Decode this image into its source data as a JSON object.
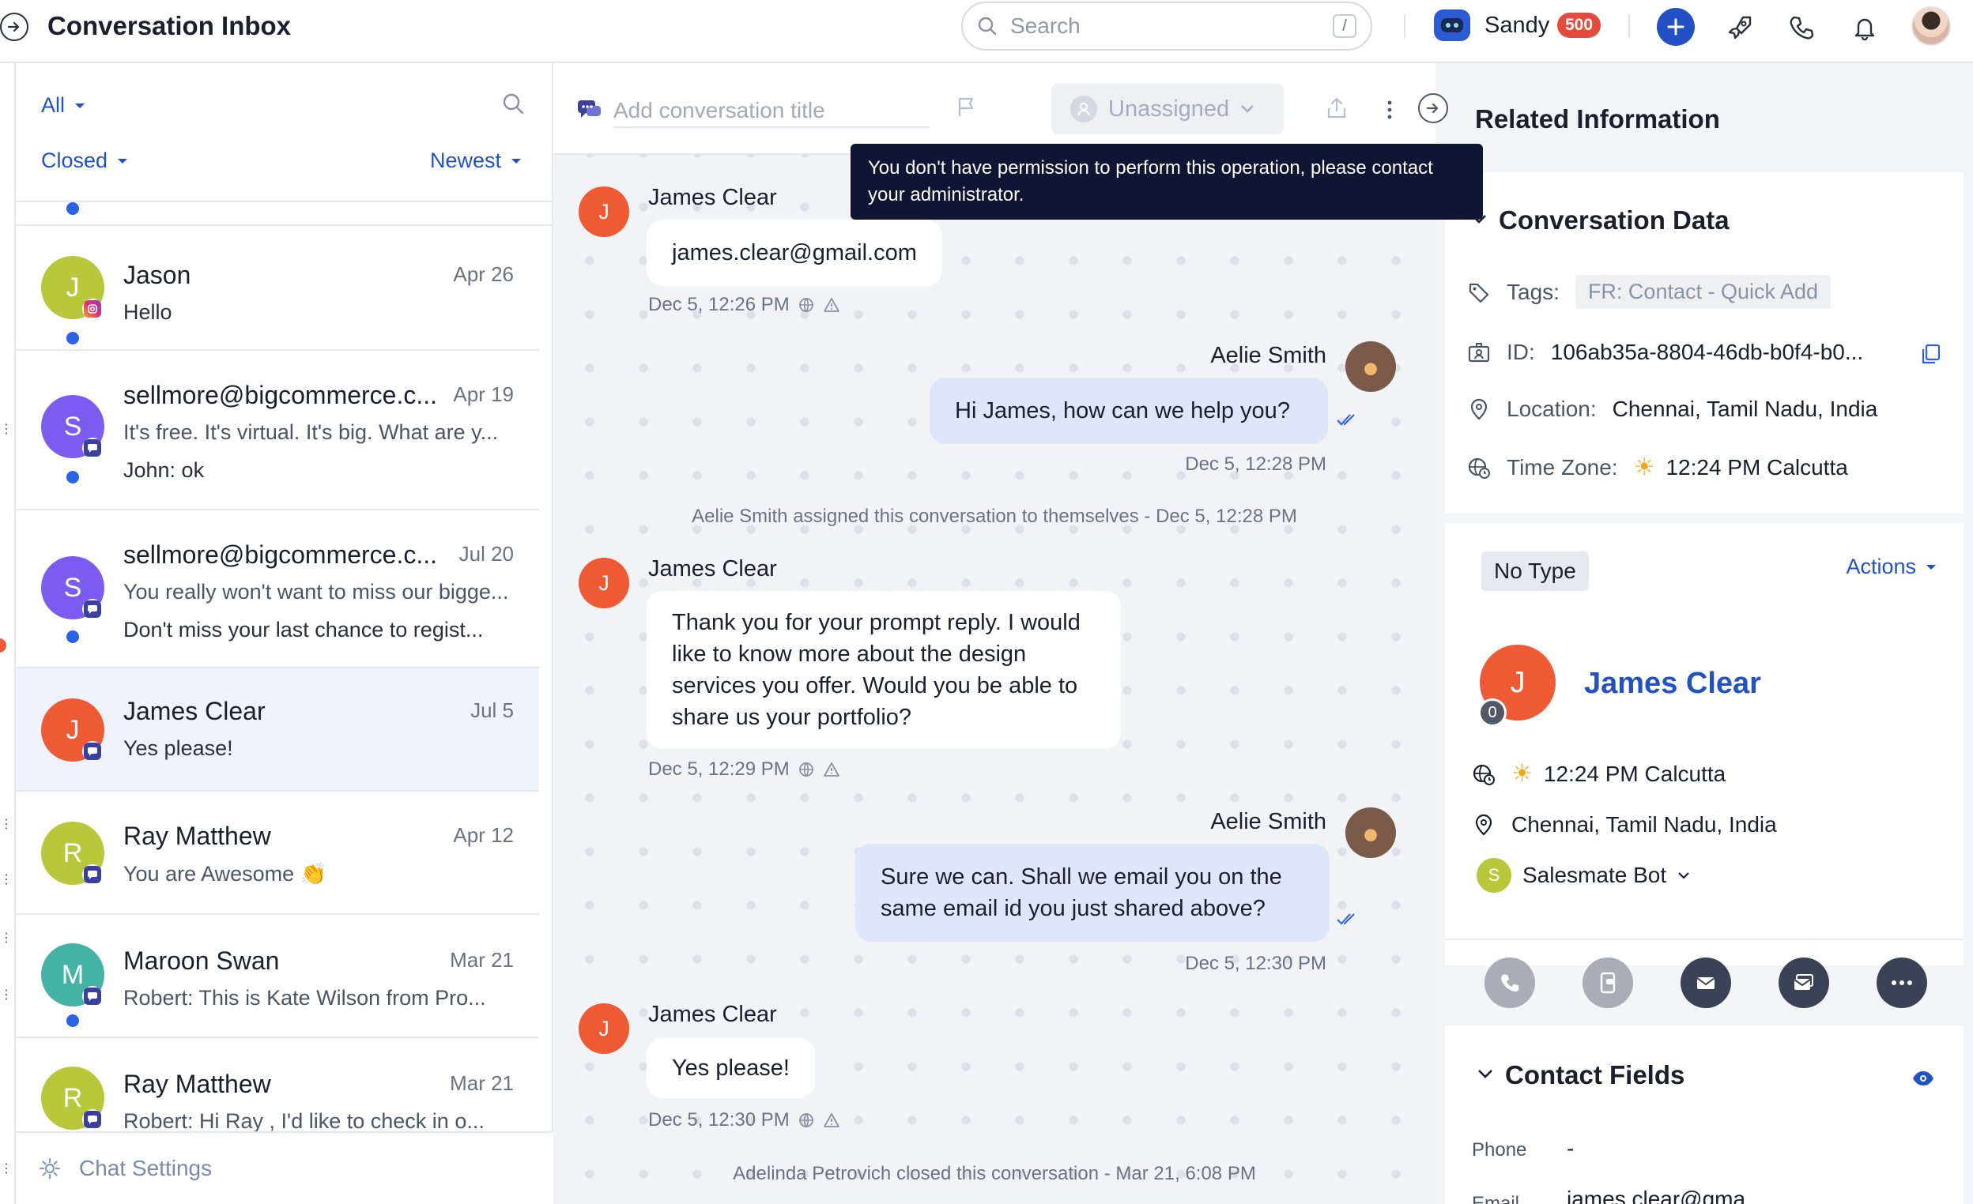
{
  "app": {
    "title": "Conversation Inbox"
  },
  "topbar": {
    "search_placeholder": "Search",
    "search_shortcut": "/",
    "user_name": "Sandy",
    "credits": "500",
    "icons": [
      "plus-icon",
      "rocket-icon",
      "phone-icon",
      "bell-icon",
      "profile-avatar"
    ]
  },
  "list": {
    "filter_all": "All",
    "filter_status": "Closed",
    "filter_sort": "Newest",
    "conversations": [
      {
        "initial": "J",
        "name": "Jason",
        "date": "Apr 26",
        "line1": "Hello",
        "line2": "",
        "avatar_color": "#b7c93a",
        "channel": "instagram-icon",
        "unread": true
      },
      {
        "initial": "S",
        "name": "sellmore@bigcommerce.c...",
        "date": "Apr 19",
        "line1": "It's free. It's virtual. It's big. What are y...",
        "line2": "John: ok",
        "avatar_color": "#7a5cf0",
        "channel": "chat-icon",
        "unread": true
      },
      {
        "initial": "S",
        "name": "sellmore@bigcommerce.c...",
        "date": "Jul 20",
        "line1": "You really won't want to miss our bigge...",
        "line2": "Don't miss your last chance to regist...",
        "avatar_color": "#7a5cf0",
        "channel": "chat-icon",
        "unread": true
      },
      {
        "initial": "J",
        "name": "James Clear",
        "date": "Jul 5",
        "line1": "Yes please!",
        "line2": "",
        "avatar_color": "#ee5a33",
        "channel": "chat-icon",
        "unread": false
      },
      {
        "initial": "R",
        "name": "Ray Matthew",
        "date": "Apr 12",
        "line1": "You are Awesome 👏",
        "line2": "",
        "avatar_color": "#b7c93a",
        "channel": "chat-icon",
        "unread": false
      },
      {
        "initial": "M",
        "name": "Maroon Swan",
        "date": "Mar 21",
        "line1": "Robert: This is Kate Wilson from Pro...",
        "line2": "",
        "avatar_color": "#45b2a6",
        "channel": "chat-icon",
        "unread": true
      },
      {
        "initial": "R",
        "name": "Ray Matthew",
        "date": "Mar 21",
        "line1": "Robert: Hi Ray , I'd like to check in o...",
        "line2": "",
        "avatar_color": "#b7c93a",
        "channel": "chat-icon",
        "unread": false
      }
    ],
    "chat_settings": "Chat Settings"
  },
  "chat": {
    "title_placeholder": "Add conversation title",
    "assignee": "Unassigned",
    "tooltip": "You don't have permission to perform this operation, please contact your administrator.",
    "messages": [
      {
        "sender": "James Clear",
        "initial": "J",
        "text": "james.clear@gmail.com",
        "time": "Dec 5, 12:26 PM"
      },
      {
        "sender": "Aelie Smith",
        "text": "Hi James, how can we help you?",
        "time": "Dec 5, 12:28 PM"
      },
      {
        "sender": "James Clear",
        "initial": "J",
        "text": "Thank you for your prompt reply. I would like to know more about the design services you offer. Would you be able to share us your portfolio?",
        "time": "Dec 5, 12:29 PM"
      },
      {
        "sender": "Aelie Smith",
        "text": "Sure we can. Shall we email you on the same email id you just shared above?",
        "time": "Dec 5, 12:30 PM"
      },
      {
        "sender": "James Clear",
        "initial": "J",
        "text": "Yes please!",
        "time": "Dec 5, 12:30 PM"
      }
    ],
    "system_events": [
      "Aelie Smith assigned this conversation to themselves - Dec 5, 12:28 PM",
      "Adelinda Petrovich closed this conversation - Mar 21, 6:08 PM"
    ]
  },
  "related": {
    "title": "Related Information",
    "conversation_data": {
      "title": "Conversation Data",
      "tags_label": "Tags:",
      "tag": "FR: Contact - Quick Add",
      "id_label": "ID:",
      "id_value": "106ab35a-8804-46db-b0f4-b0...",
      "location_label": "Location:",
      "location_value": "Chennai, Tamil Nadu, India",
      "timezone_label": "Time Zone:",
      "timezone_value": "12:24 PM Calcutta"
    },
    "contact": {
      "type": "No Type",
      "actions": "Actions",
      "initial": "J",
      "count": "0",
      "name": "James Clear",
      "time": "12:24 PM Calcutta",
      "location": "Chennai, Tamil Nadu, India",
      "owner_initial": "S",
      "owner": "Salesmate Bot"
    },
    "contact_fields": {
      "title": "Contact Fields",
      "phone_label": "Phone",
      "phone_value": "-",
      "email_label": "Email",
      "email_value": "james.clear@gma..."
    }
  }
}
